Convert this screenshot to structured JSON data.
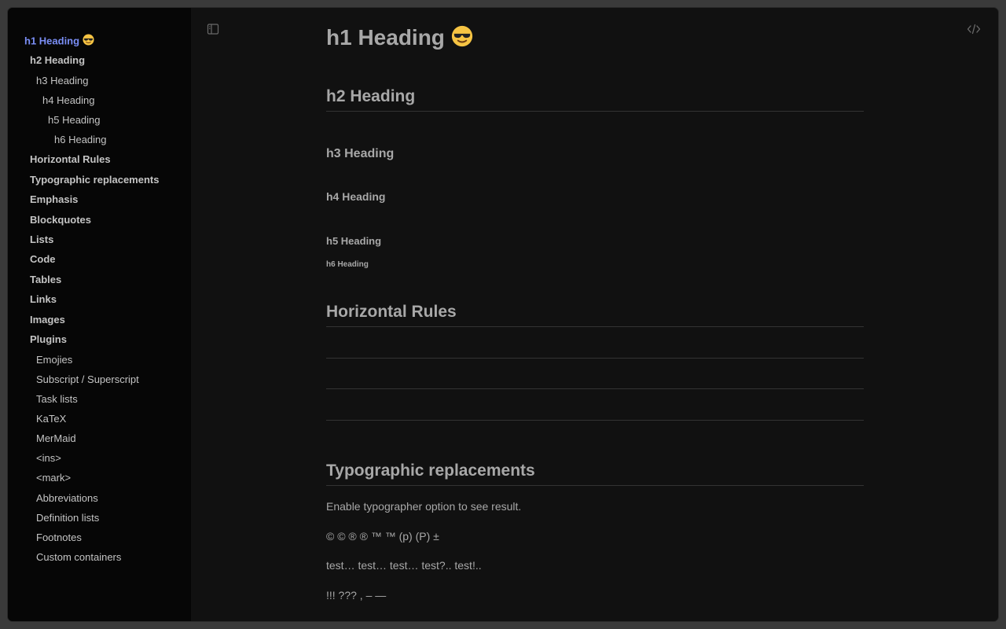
{
  "sidebar": {
    "items": [
      {
        "label": "h1 Heading",
        "level": 1,
        "emoji": "sunglasses",
        "active": true
      },
      {
        "label": "h2 Heading",
        "level": 2
      },
      {
        "label": "h3 Heading",
        "level": 3
      },
      {
        "label": "h4 Heading",
        "level": 4
      },
      {
        "label": "h5 Heading",
        "level": 5
      },
      {
        "label": "h6 Heading",
        "level": 6
      },
      {
        "label": "Horizontal Rules",
        "level": 2
      },
      {
        "label": "Typographic replacements",
        "level": 2
      },
      {
        "label": "Emphasis",
        "level": 2
      },
      {
        "label": "Blockquotes",
        "level": 2
      },
      {
        "label": "Lists",
        "level": 2
      },
      {
        "label": "Code",
        "level": 2
      },
      {
        "label": "Tables",
        "level": 2
      },
      {
        "label": "Links",
        "level": 2
      },
      {
        "label": "Images",
        "level": 2
      },
      {
        "label": "Plugins",
        "level": 2
      },
      {
        "label": "Emojies",
        "level": 3
      },
      {
        "label": "Subscript / Superscript",
        "level": 3
      },
      {
        "label": "Task lists",
        "level": 3
      },
      {
        "label": "KaTeX",
        "level": 3
      },
      {
        "label": "MerMaid",
        "level": 3
      },
      {
        "label": "<ins>",
        "level": 3
      },
      {
        "label": "<mark>",
        "level": 3
      },
      {
        "label": "Abbreviations",
        "level": 3
      },
      {
        "label": "Definition lists",
        "level": 3
      },
      {
        "label": "Footnotes",
        "level": 3
      },
      {
        "label": "Custom containers",
        "level": 3
      }
    ]
  },
  "toolbar": {
    "toggle_sidebar_icon": "sidebar-toggle-icon",
    "source_view_icon": "code-icon"
  },
  "document": {
    "h1": "h1 Heading",
    "h1_emoji": "sunglasses",
    "h2": "h2 Heading",
    "h3": "h3 Heading",
    "h4": "h4 Heading",
    "h5": "h5 Heading",
    "h6": "h6 Heading",
    "horizontal_rules": "Horizontal Rules",
    "typographic_replacements": "Typographic replacements",
    "typographer_note": "Enable typographer option to see result.",
    "symbols_line": "© © ® ® ™ ™ (p) (P) ±",
    "ellipsis_line": "test… test… test… test?.. test!..",
    "punctuation_line": "!!! ??? , – —"
  },
  "colors": {
    "accent": "#7a8ef5",
    "text": "#a8a8a8",
    "sidebar_bg": "#060606",
    "main_bg": "#111111",
    "rule": "#333333"
  }
}
